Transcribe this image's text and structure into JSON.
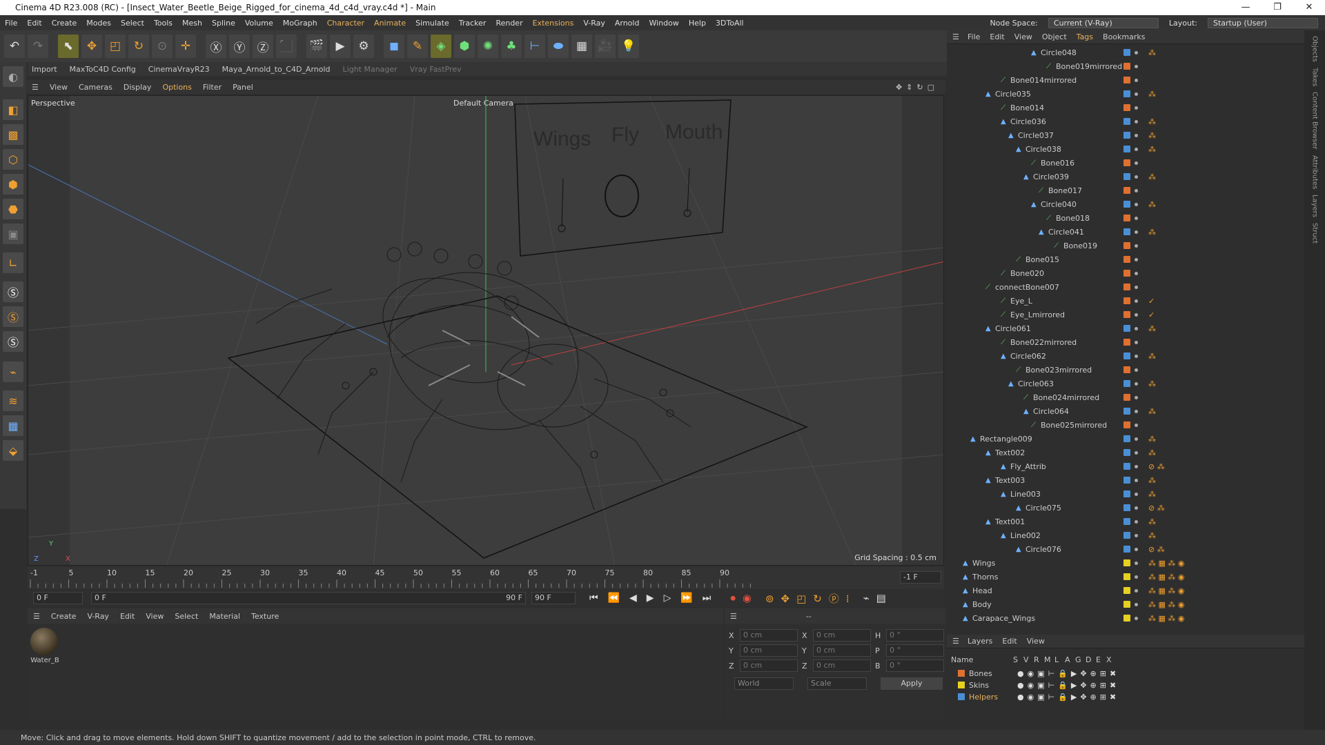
{
  "window": {
    "title": "Cinema 4D R23.008 (RC) - [Insect_Water_Beetle_Beige_Rigged_for_cinema_4d_c4d_vray.c4d *] - Main",
    "minimize": "—",
    "maximize": "❐",
    "close": "✕"
  },
  "menu": {
    "items": [
      "File",
      "Edit",
      "Create",
      "Modes",
      "Select",
      "Tools",
      "Mesh",
      "Spline",
      "Volume",
      "MoGraph",
      "Character",
      "Animate",
      "Simulate",
      "Tracker",
      "Render",
      "Extensions",
      "V-Ray",
      "Arnold",
      "Window",
      "Help",
      "3DToAll"
    ],
    "node_space_label": "Node Space:",
    "node_space_value": "Current (V-Ray)",
    "layout_label": "Layout:",
    "layout_value": "Startup (User)"
  },
  "plugins": {
    "import": "Import",
    "maxto": "MaxToC4D Config",
    "cvray": "CinemaVrayR23",
    "maya": "Maya_Arnold_to_C4D_Arnold",
    "light": "Light Manager",
    "vfp": "Vray FastPrev"
  },
  "viewport": {
    "menu": [
      "View",
      "Cameras",
      "Display",
      "Options",
      "Filter",
      "Panel"
    ],
    "label": "Perspective",
    "camera": "Default Camera",
    "grid_spacing": "Grid Spacing : 0.5 cm",
    "board_labels": [
      "Wings",
      "Fly",
      "Mouth"
    ]
  },
  "timeline": {
    "ticks": [
      "-1",
      "5",
      "10",
      "15",
      "20",
      "25",
      "30",
      "35",
      "40",
      "45",
      "50",
      "55",
      "60",
      "65",
      "70",
      "75",
      "80",
      "85",
      "90"
    ],
    "frame_end_label": "-1 F",
    "start": "0 F",
    "current": "0 F",
    "end": "90 F",
    "end2": "90 F"
  },
  "materials": {
    "menu": [
      "Create",
      "V-Ray",
      "Edit",
      "View",
      "Select",
      "Material",
      "Texture"
    ],
    "item": "Water_B"
  },
  "coords": {
    "dash": "--",
    "rows": [
      [
        "X",
        "0 cm",
        "X",
        "0 cm",
        "H",
        "0 °"
      ],
      [
        "Y",
        "0 cm",
        "Y",
        "0 cm",
        "P",
        "0 °"
      ],
      [
        "Z",
        "0 cm",
        "Z",
        "0 cm",
        "B",
        "0 °"
      ]
    ],
    "world": "World",
    "scale": "Scale",
    "apply": "Apply"
  },
  "objects": {
    "menu": [
      "File",
      "Edit",
      "View",
      "Object",
      "Tags",
      "Bookmarks"
    ],
    "rows": [
      {
        "n": "Circle048",
        "i": 10,
        "c": "#4a8fd6",
        "t": "⁂"
      },
      {
        "n": "Bone019mirrored",
        "i": 12,
        "c": "#e07030",
        "t": ""
      },
      {
        "n": "Bone014mirrored",
        "i": 6,
        "c": "#e07030",
        "t": ""
      },
      {
        "n": "Circle035",
        "i": 4,
        "c": "#4a8fd6",
        "t": "⁂"
      },
      {
        "n": "Bone014",
        "i": 6,
        "c": "#e07030",
        "t": ""
      },
      {
        "n": "Circle036",
        "i": 6,
        "c": "#4a8fd6",
        "t": "⁂"
      },
      {
        "n": "Circle037",
        "i": 7,
        "c": "#4a8fd6",
        "t": "⁂"
      },
      {
        "n": "Circle038",
        "i": 8,
        "c": "#4a8fd6",
        "t": "⁂"
      },
      {
        "n": "Bone016",
        "i": 10,
        "c": "#e07030",
        "t": ""
      },
      {
        "n": "Circle039",
        "i": 9,
        "c": "#4a8fd6",
        "t": "⁂"
      },
      {
        "n": "Bone017",
        "i": 11,
        "c": "#e07030",
        "t": ""
      },
      {
        "n": "Circle040",
        "i": 10,
        "c": "#4a8fd6",
        "t": "⁂"
      },
      {
        "n": "Bone018",
        "i": 12,
        "c": "#e07030",
        "t": ""
      },
      {
        "n": "Circle041",
        "i": 11,
        "c": "#4a8fd6",
        "t": "⁂"
      },
      {
        "n": "Bone019",
        "i": 13,
        "c": "#e07030",
        "t": ""
      },
      {
        "n": "Bone015",
        "i": 8,
        "c": "#e07030",
        "t": ""
      },
      {
        "n": "Bone020",
        "i": 6,
        "c": "#e07030",
        "t": ""
      },
      {
        "n": "connectBone007",
        "i": 4,
        "c": "#e07030",
        "t": ""
      },
      {
        "n": "Eye_L",
        "i": 6,
        "c": "#e07030",
        "t": "✓"
      },
      {
        "n": "Eye_Lmirrored",
        "i": 6,
        "c": "#e07030",
        "t": "✓"
      },
      {
        "n": "Circle061",
        "i": 4,
        "c": "#4a8fd6",
        "t": "⁂"
      },
      {
        "n": "Bone022mirrored",
        "i": 6,
        "c": "#e07030",
        "t": ""
      },
      {
        "n": "Circle062",
        "i": 6,
        "c": "#4a8fd6",
        "t": "⁂"
      },
      {
        "n": "Bone023mirrored",
        "i": 8,
        "c": "#e07030",
        "t": ""
      },
      {
        "n": "Circle063",
        "i": 7,
        "c": "#4a8fd6",
        "t": "⁂"
      },
      {
        "n": "Bone024mirrored",
        "i": 9,
        "c": "#e07030",
        "t": ""
      },
      {
        "n": "Circle064",
        "i": 9,
        "c": "#4a8fd6",
        "t": "⁂"
      },
      {
        "n": "Bone025mirrored",
        "i": 10,
        "c": "#e07030",
        "t": ""
      },
      {
        "n": "Rectangle009",
        "i": 2,
        "c": "#4a8fd6",
        "t": "⁂"
      },
      {
        "n": "Text002",
        "i": 4,
        "c": "#4a8fd6",
        "t": "⁂"
      },
      {
        "n": "Fly_Attrib",
        "i": 6,
        "c": "#4a8fd6",
        "t": "⊘ ⁂"
      },
      {
        "n": "Text003",
        "i": 4,
        "c": "#4a8fd6",
        "t": "⁂"
      },
      {
        "n": "Line003",
        "i": 6,
        "c": "#4a8fd6",
        "t": "⁂"
      },
      {
        "n": "Circle075",
        "i": 8,
        "c": "#4a8fd6",
        "t": "⊘ ⁂"
      },
      {
        "n": "Text001",
        "i": 4,
        "c": "#4a8fd6",
        "t": "⁂"
      },
      {
        "n": "Line002",
        "i": 6,
        "c": "#4a8fd6",
        "t": "⁂"
      },
      {
        "n": "Circle076",
        "i": 8,
        "c": "#4a8fd6",
        "t": "⊘ ⁂"
      },
      {
        "n": "Wings",
        "i": 1,
        "c": "#e6d020",
        "t": "⁂ ▦ ⁂ ◉"
      },
      {
        "n": "Thorns",
        "i": 1,
        "c": "#e6d020",
        "t": "⁂ ▦ ⁂ ◉"
      },
      {
        "n": "Head",
        "i": 1,
        "c": "#e6d020",
        "t": "⁂ ▦ ⁂ ◉"
      },
      {
        "n": "Body",
        "i": 1,
        "c": "#e6d020",
        "t": "⁂ ▦ ⁂ ◉"
      },
      {
        "n": "Carapace_Wings",
        "i": 1,
        "c": "#e6d020",
        "t": "⁂ ▦ ⁂ ◉"
      }
    ]
  },
  "layers": {
    "menu": [
      "Layers",
      "Edit",
      "View"
    ],
    "name_header": "Name",
    "cols": [
      "S",
      "V",
      "R",
      "M",
      "L",
      "A",
      "G",
      "D",
      "E",
      "X"
    ],
    "rows": [
      {
        "n": "Bones",
        "c": "#e07030"
      },
      {
        "n": "Skins",
        "c": "#e6d020"
      },
      {
        "n": "Helpers",
        "c": "#4a8fd6"
      }
    ]
  },
  "side_tabs": [
    "Objects",
    "Takes",
    "Content Browser",
    "Attributes",
    "Layers",
    "Struct"
  ],
  "status": "Move: Click and drag to move elements. Hold down SHIFT to quantize movement / add to the selection in point mode, CTRL to remove."
}
